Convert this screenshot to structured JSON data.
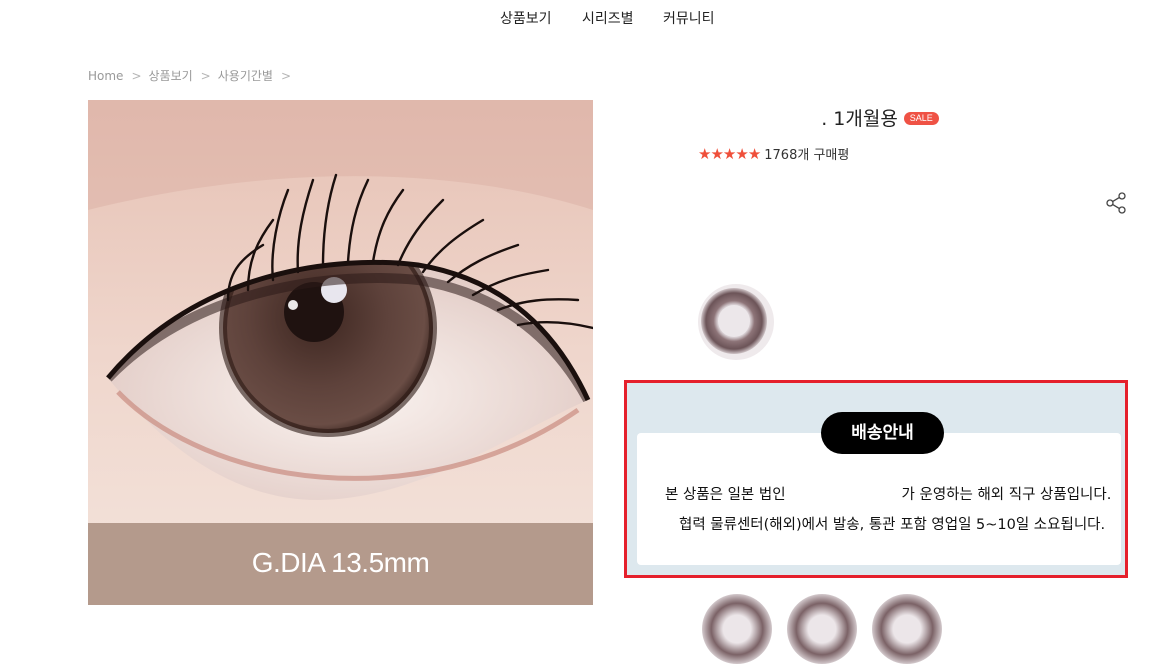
{
  "nav": {
    "items": [
      "상품보기",
      "시리즈별",
      "커뮤니티"
    ]
  },
  "breadcrumb": {
    "items": [
      "Home",
      "상품보기",
      "사용기간별"
    ],
    "separator": ">"
  },
  "product": {
    "photo": {
      "overlay_text": "G.DIA 13.5mm"
    },
    "title": ". 1개월용",
    "badge": "SALE",
    "rating": {
      "stars": 5,
      "review_count_text": "1768개 구매평"
    }
  },
  "shipping": {
    "title": "배송안내",
    "line1_start": "본 상품은 일본 법인",
    "line1_end": "가 운영하는 해외 직구 상품입니다.",
    "line2": "협력 물류센터(해외)에서 발송, 통관 포함 영업일 5~10일 소요됩니다."
  },
  "colors": {
    "accent_red": "#ef4f3a",
    "sale_badge": "#ef5245",
    "highlight_border": "#e5202c",
    "shipping_bg": "#dde8ee",
    "photo_band": "#b49a8c"
  },
  "icons": {
    "share": "share-icon",
    "breadcrumb_separator": "chevron-right-icon",
    "star": "star-icon"
  }
}
